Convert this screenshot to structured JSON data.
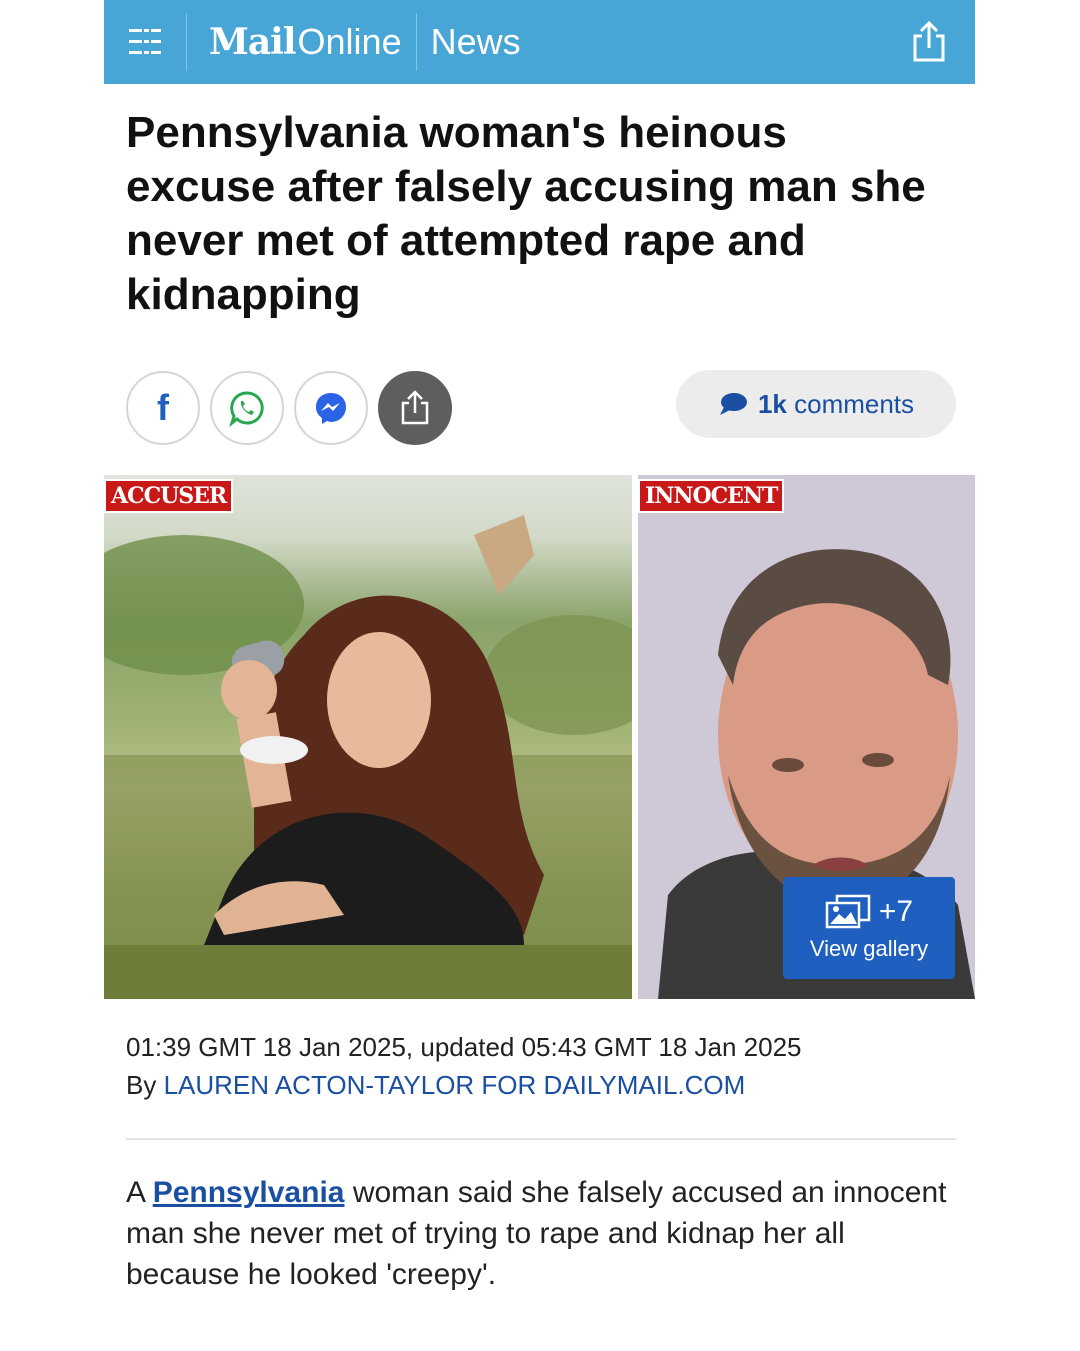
{
  "header": {
    "brand_mail": "Mail",
    "brand_online": "Online",
    "section": "News",
    "background_color": "#48a6d6"
  },
  "article": {
    "headline": "Pennsylvania woman's heinous excuse after falsely accusing man she never met of attempted rape and kidnapping",
    "comments_count": "1k",
    "comments_label": "comments",
    "images": {
      "left_tag": "ACCUSER",
      "right_tag": "INNOCENT",
      "gallery_count": "+7",
      "gallery_label": "View gallery"
    },
    "dateline": "01:39 GMT 18 Jan 2025, updated 05:43 GMT 18 Jan 2025",
    "byline_prefix": "By",
    "author": "LAUREN ACTON-TAYLOR FOR DAILYMAIL.COM",
    "body": {
      "lead": "A",
      "link_text": "Pennsylvania",
      "rest": "woman said she falsely accused an innocent man she never met of trying to rape and kidnap her all because he looked 'creepy'."
    }
  },
  "share": {
    "facebook_label": "f",
    "icons": [
      "facebook-icon",
      "whatsapp-icon",
      "messenger-icon",
      "share-icon"
    ]
  },
  "colors": {
    "link_blue": "#1a4fa3",
    "tag_red": "#c81818",
    "gallery_blue": "#1f5fbf"
  }
}
